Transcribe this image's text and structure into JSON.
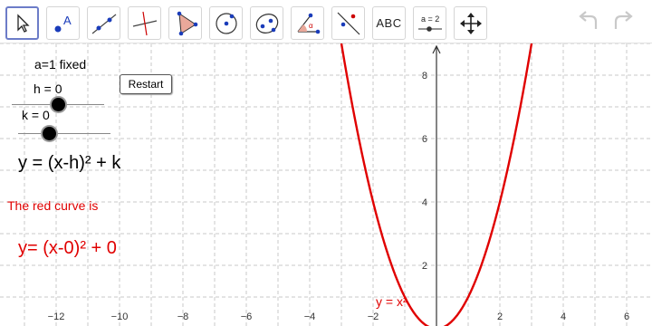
{
  "toolbar": {
    "tools": [
      {
        "name": "move-tool",
        "icon": "cursor-icon"
      },
      {
        "name": "point-tool",
        "icon": "point-icon",
        "text": "A"
      },
      {
        "name": "line-tool",
        "icon": "line-icon"
      },
      {
        "name": "perpendicular-tool",
        "icon": "perpendicular-line-icon"
      },
      {
        "name": "polygon-tool",
        "icon": "polygon-icon"
      },
      {
        "name": "circle-tool",
        "icon": "circle-icon"
      },
      {
        "name": "conic-tool",
        "icon": "ellipse-icon"
      },
      {
        "name": "angle-tool",
        "icon": "angle-icon",
        "text": "α"
      },
      {
        "name": "reflect-tool",
        "icon": "reflect-icon"
      },
      {
        "name": "text-tool",
        "icon": "text-icon",
        "text": "ABC"
      },
      {
        "name": "slider-tool",
        "icon": "slider-icon",
        "text": "a = 2"
      },
      {
        "name": "move-graphics-tool",
        "icon": "move-arrows-icon"
      }
    ],
    "undo_icon": "undo-icon",
    "redo_icon": "redo-icon"
  },
  "panel": {
    "a_fixed": "a=1 fixed",
    "h_label": "h = 0",
    "k_label": "k = 0",
    "restart_label": "Restart",
    "formula": "y = (x-h)² + k",
    "red_curve_text": "The red curve is",
    "red_formula": "y= (x-0)² + 0"
  },
  "graph": {
    "x_ticks": [
      "−12",
      "−10",
      "−8",
      "−6",
      "−4",
      "−2",
      "2",
      "4",
      "6"
    ],
    "y_ticks": [
      "8",
      "6",
      "4",
      "2"
    ],
    "curve_label": "y = x²",
    "curve_color": "#e00000"
  }
}
